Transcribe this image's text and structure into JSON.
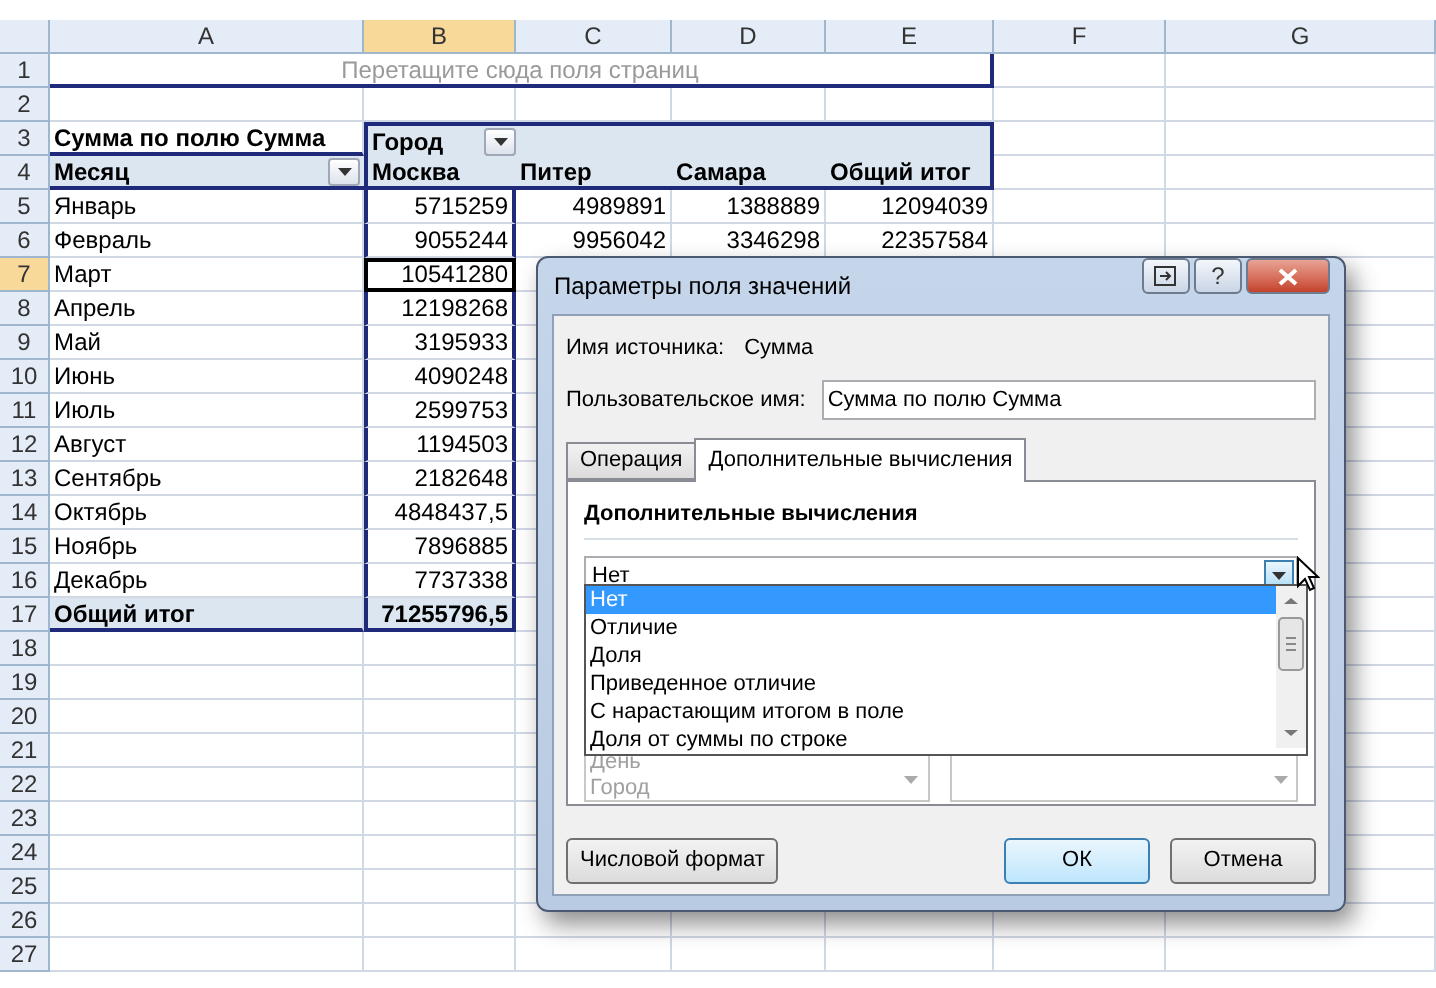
{
  "columns": [
    {
      "label": "A",
      "selected": false
    },
    {
      "label": "B",
      "selected": true
    },
    {
      "label": "C",
      "selected": false
    },
    {
      "label": "D",
      "selected": false
    },
    {
      "label": "E",
      "selected": false
    },
    {
      "label": "F",
      "selected": false
    },
    {
      "label": "G",
      "selected": false
    }
  ],
  "rows": [
    {
      "number": "1",
      "selected": false,
      "kind": "drop-zone",
      "text": "Перетащите сюда поля страниц"
    },
    {
      "number": "2",
      "selected": false,
      "kind": "blank"
    },
    {
      "number": "3",
      "selected": false,
      "kind": "pivot-header",
      "cells": [
        {
          "text": "Сумма по полю Сумма",
          "filter": false
        },
        {
          "text": "Город",
          "filter": true
        }
      ]
    },
    {
      "number": "4",
      "selected": false,
      "kind": "pivot-columns",
      "cells": [
        {
          "text": "Месяц",
          "filter": true
        },
        {
          "text": "Москва",
          "filter": false
        },
        {
          "text": "Питер",
          "filter": false
        },
        {
          "text": "Самара",
          "filter": false
        },
        {
          "text": "Общий итог",
          "filter": false
        }
      ]
    },
    {
      "number": "5",
      "selected": false,
      "kind": "data",
      "cells": [
        "Январь",
        "5715259",
        "4989891",
        "1388889",
        "12094039"
      ]
    },
    {
      "number": "6",
      "selected": false,
      "kind": "data",
      "cells": [
        "Февраль",
        "9055244",
        "9956042",
        "3346298",
        "22357584"
      ]
    },
    {
      "number": "7",
      "selected": true,
      "kind": "data",
      "cells": [
        "Март",
        "10541280"
      ]
    },
    {
      "number": "8",
      "selected": false,
      "kind": "data",
      "cells": [
        "Апрель",
        "12198268"
      ]
    },
    {
      "number": "9",
      "selected": false,
      "kind": "data",
      "cells": [
        "Май",
        "3195933"
      ]
    },
    {
      "number": "10",
      "selected": false,
      "kind": "data",
      "cells": [
        "Июнь",
        "4090248"
      ]
    },
    {
      "number": "11",
      "selected": false,
      "kind": "data",
      "cells": [
        "Июль",
        "2599753"
      ]
    },
    {
      "number": "12",
      "selected": false,
      "kind": "data",
      "cells": [
        "Август",
        "1194503"
      ]
    },
    {
      "number": "13",
      "selected": false,
      "kind": "data",
      "cells": [
        "Сентябрь",
        "2182648"
      ]
    },
    {
      "number": "14",
      "selected": false,
      "kind": "data",
      "cells": [
        "Октябрь",
        "4848437,5"
      ]
    },
    {
      "number": "15",
      "selected": false,
      "kind": "data",
      "cells": [
        "Ноябрь",
        "7896885"
      ]
    },
    {
      "number": "16",
      "selected": false,
      "kind": "data",
      "cells": [
        "Декабрь",
        "7737338"
      ]
    },
    {
      "number": "17",
      "selected": false,
      "kind": "total",
      "cells": [
        "Общий итог",
        "71255796,5"
      ]
    },
    {
      "number": "18",
      "selected": false,
      "kind": "blank"
    },
    {
      "number": "19",
      "selected": false,
      "kind": "blank"
    },
    {
      "number": "20",
      "selected": false,
      "kind": "blank"
    },
    {
      "number": "21",
      "selected": false,
      "kind": "blank"
    },
    {
      "number": "22",
      "selected": false,
      "kind": "blank"
    },
    {
      "number": "23",
      "selected": false,
      "kind": "blank"
    },
    {
      "number": "24",
      "selected": false,
      "kind": "blank"
    },
    {
      "number": "25",
      "selected": false,
      "kind": "blank"
    },
    {
      "number": "26",
      "selected": false,
      "kind": "blank"
    },
    {
      "number": "27",
      "selected": false,
      "kind": "blank"
    }
  ],
  "dialog": {
    "title": "Параметры поля значений",
    "title_buttons": [
      {
        "kind": "restore"
      },
      {
        "kind": "help",
        "label": "?"
      },
      {
        "kind": "close"
      }
    ],
    "source_label": "Имя источника:",
    "source_value": "Сумма",
    "custom_name_label": "Пользовательское имя:",
    "custom_name_value": "Сумма по полю Сумма",
    "tabs": [
      {
        "label": "Операция",
        "selected": false
      },
      {
        "label": "Дополнительные вычисления",
        "selected": true
      }
    ],
    "calculation": {
      "heading": "Дополнительные вычисления",
      "value": "Нет",
      "open": true,
      "options": [
        {
          "label": "Нет",
          "selected": true
        },
        {
          "label": "Отличие",
          "selected": false
        },
        {
          "label": "Доля",
          "selected": false
        },
        {
          "label": "Приведенное отличие",
          "selected": false
        },
        {
          "label": "С нарастающим итогом в поле",
          "selected": false
        },
        {
          "label": "Доля от суммы по строке",
          "selected": false
        }
      ]
    },
    "base_field": {
      "disabled": true,
      "items": [
        "День",
        "Город"
      ]
    },
    "base_item": {
      "disabled": true
    },
    "buttons": [
      {
        "label": "Числовой формат",
        "default": false
      },
      {
        "label": "ОК",
        "default": true
      },
      {
        "label": "Отмена",
        "default": false
      }
    ]
  }
}
